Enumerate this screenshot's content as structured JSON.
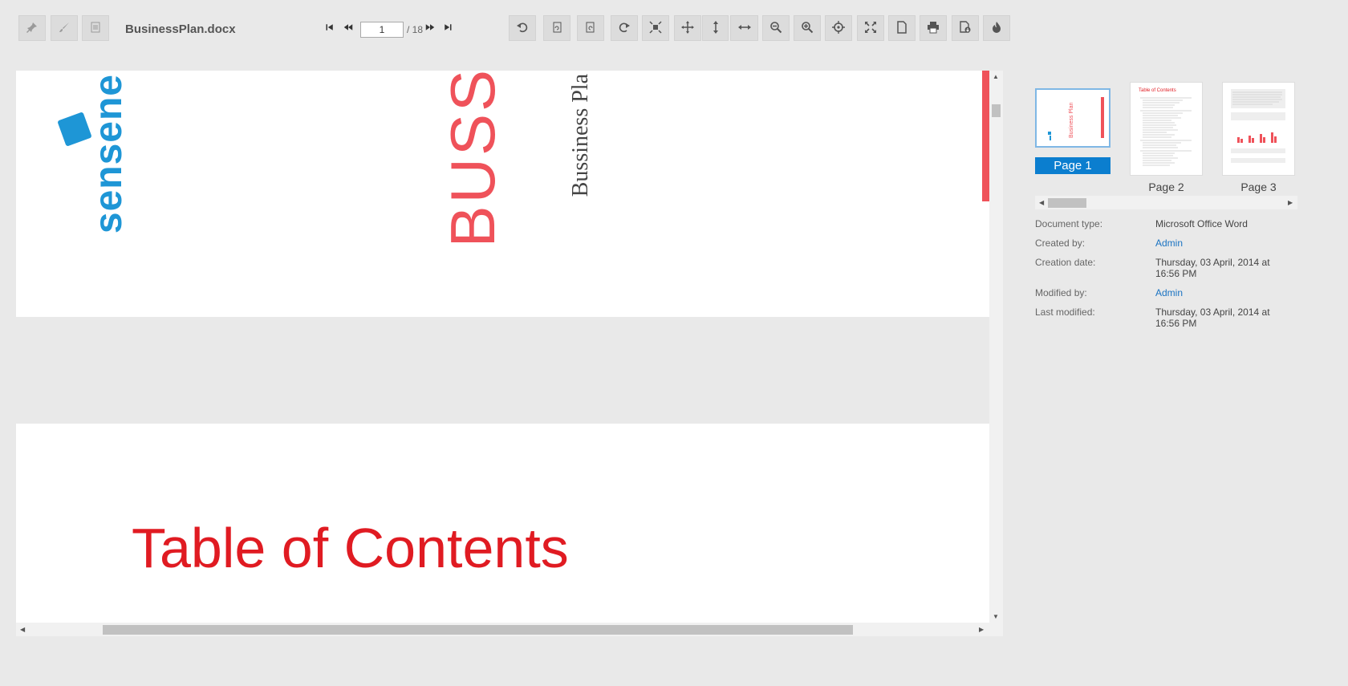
{
  "toolbar": {
    "document_name": "BusinessPlan.docx",
    "current_page": "1",
    "page_total": "/ 18",
    "left_tools": [
      "pin-icon",
      "brush-icon",
      "document-icon"
    ],
    "right_tools": [
      "undo-icon",
      "rotate-left-icon",
      "rotate-right-icon",
      "redo-icon",
      "fit-page-icon",
      "pan-icon",
      "fit-height-icon",
      "fit-width-icon",
      "zoom-out-icon",
      "zoom-in-icon",
      "target-icon",
      "fullscreen-icon",
      "single-page-icon",
      "print-icon",
      "download-icon",
      "fire-icon"
    ]
  },
  "document": {
    "logo_text": "sensene",
    "cover_title_large": "BUSS",
    "cover_title_small": "Bussiness Pla",
    "toc_heading": "Table of Contents",
    "accent_color": "#ef525a",
    "logo_color": "#1e96d6"
  },
  "thumbnails": [
    {
      "label": "Page 1",
      "selected": true
    },
    {
      "label": "Page 2",
      "selected": false
    },
    {
      "label": "Page 3",
      "selected": false
    }
  ],
  "properties": [
    {
      "label": "Document type:",
      "value": "Microsoft Office Word",
      "link": false
    },
    {
      "label": "Created by:",
      "value": "Admin",
      "link": true
    },
    {
      "label": "Creation date:",
      "value": "Thursday, 03 April, 2014 at 16:56 PM",
      "link": false
    },
    {
      "label": "Modified by:",
      "value": "Admin",
      "link": true
    },
    {
      "label": "Last modified:",
      "value": "Thursday, 03 April, 2014 at 16:56 PM",
      "link": false
    }
  ]
}
